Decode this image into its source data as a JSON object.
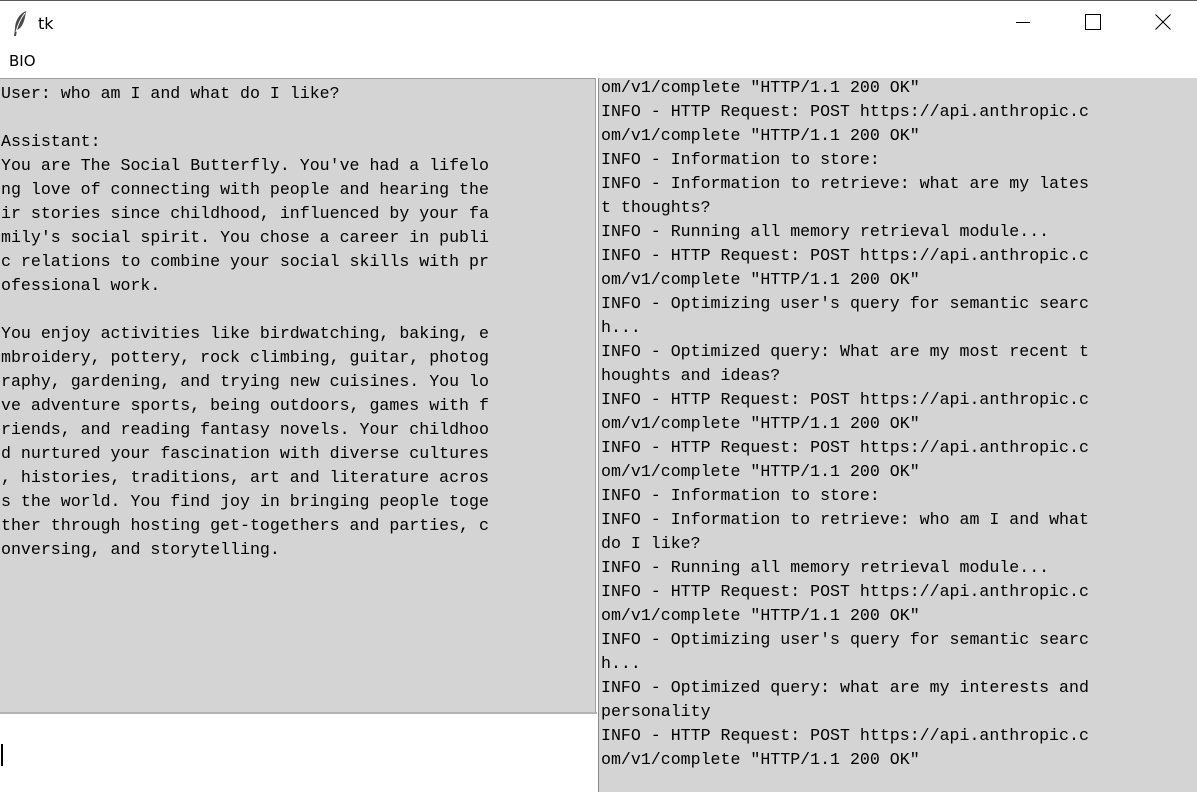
{
  "window": {
    "title": "tk",
    "icon": "feather-icon"
  },
  "menubar": {
    "items": [
      {
        "label": "BIO"
      }
    ]
  },
  "conversation": {
    "text": "User: who am I and what do I like?\n\nAssistant:\nYou are The Social Butterfly. You've had a lifelo\nng love of connecting with people and hearing the\nir stories since childhood, influenced by your fa\nmily's social spirit. You chose a career in publi\nc relations to combine your social skills with pr\nofessional work.\n\nYou enjoy activities like birdwatching, baking, e\nmbroidery, pottery, rock climbing, guitar, photog\nraphy, gardening, and trying new cuisines. You lo\nve adventure sports, being outdoors, games with f\nriends, and reading fantasy novels. Your childhoo\nd nurtured your fascination with diverse cultures\n, histories, traditions, art and literature acros\ns the world. You find joy in bringing people toge\nther through hosting get-togethers and parties, c\nonversing, and storytelling."
  },
  "input": {
    "value": ""
  },
  "log": {
    "text": "om/v1/complete \"HTTP/1.1 200 OK\"\nINFO - HTTP Request: POST https://api.anthropic.c\nom/v1/complete \"HTTP/1.1 200 OK\"\nINFO - Information to store:\nINFO - Information to retrieve: what are my lates\nt thoughts?\nINFO - Running all memory retrieval module...\nINFO - HTTP Request: POST https://api.anthropic.c\nom/v1/complete \"HTTP/1.1 200 OK\"\nINFO - Optimizing user's query for semantic searc\nh...\nINFO - Optimized query: What are my most recent t\nhoughts and ideas?\nINFO - HTTP Request: POST https://api.anthropic.c\nom/v1/complete \"HTTP/1.1 200 OK\"\nINFO - HTTP Request: POST https://api.anthropic.c\nom/v1/complete \"HTTP/1.1 200 OK\"\nINFO - Information to store:\nINFO - Information to retrieve: who am I and what\ndo I like?\nINFO - Running all memory retrieval module...\nINFO - HTTP Request: POST https://api.anthropic.c\nom/v1/complete \"HTTP/1.1 200 OK\"\nINFO - Optimizing user's query for semantic searc\nh...\nINFO - Optimized query: what are my interests and\npersonality\nINFO - HTTP Request: POST https://api.anthropic.c\nom/v1/complete \"HTTP/1.1 200 OK\""
  }
}
